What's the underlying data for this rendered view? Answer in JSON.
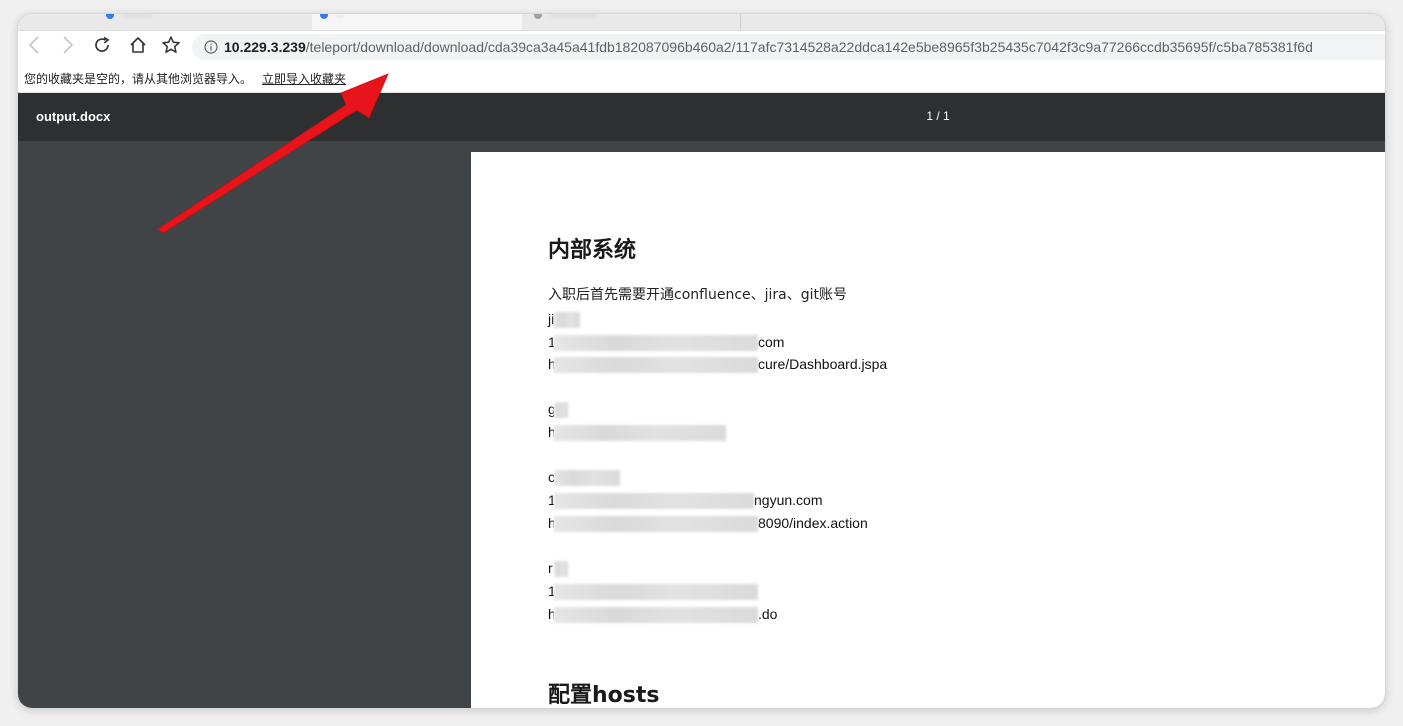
{
  "browser": {
    "url_host": "10.229.3.239",
    "url_path": "/teleport/download/download/cda39ca3a45a41fdb182087096b460a2/117afc7314528a22ddca142e5be8965f3b25435c7042f3c9a77266ccdb35695f/c5ba785381f6d",
    "bookmarks_message": "您的收藏夹是空的，请从其他浏览器导入。",
    "bookmarks_import_link": "立即导入收藏夹"
  },
  "viewer": {
    "file_name": "output.docx",
    "page_indicator": "1 / 1"
  },
  "document": {
    "heading_1": "内部系统",
    "intro": "入职后首先需要开通confluence、jira、git账号",
    "lines": {
      "jira_name": "ji",
      "jira_account": "1",
      "jira_account_tail": "com",
      "jira_url": "h",
      "jira_url_tail": "cure/Dashboard.jspa",
      "git_name": "g",
      "git_url": "h",
      "confluence_name": "c",
      "confluence_account": "1",
      "confluence_account_tail": "ngyun.com",
      "confluence_url": "h",
      "confluence_url_tail": "8090/index.action",
      "other_name": "r",
      "other_account": "1",
      "other_url": "h",
      "other_url_tail": ".do"
    },
    "heading_2": "配置hosts"
  },
  "colors": {
    "annotation_arrow": "#e8141b",
    "viewer_header": "#2d2f31",
    "viewer_background": "#414446"
  }
}
